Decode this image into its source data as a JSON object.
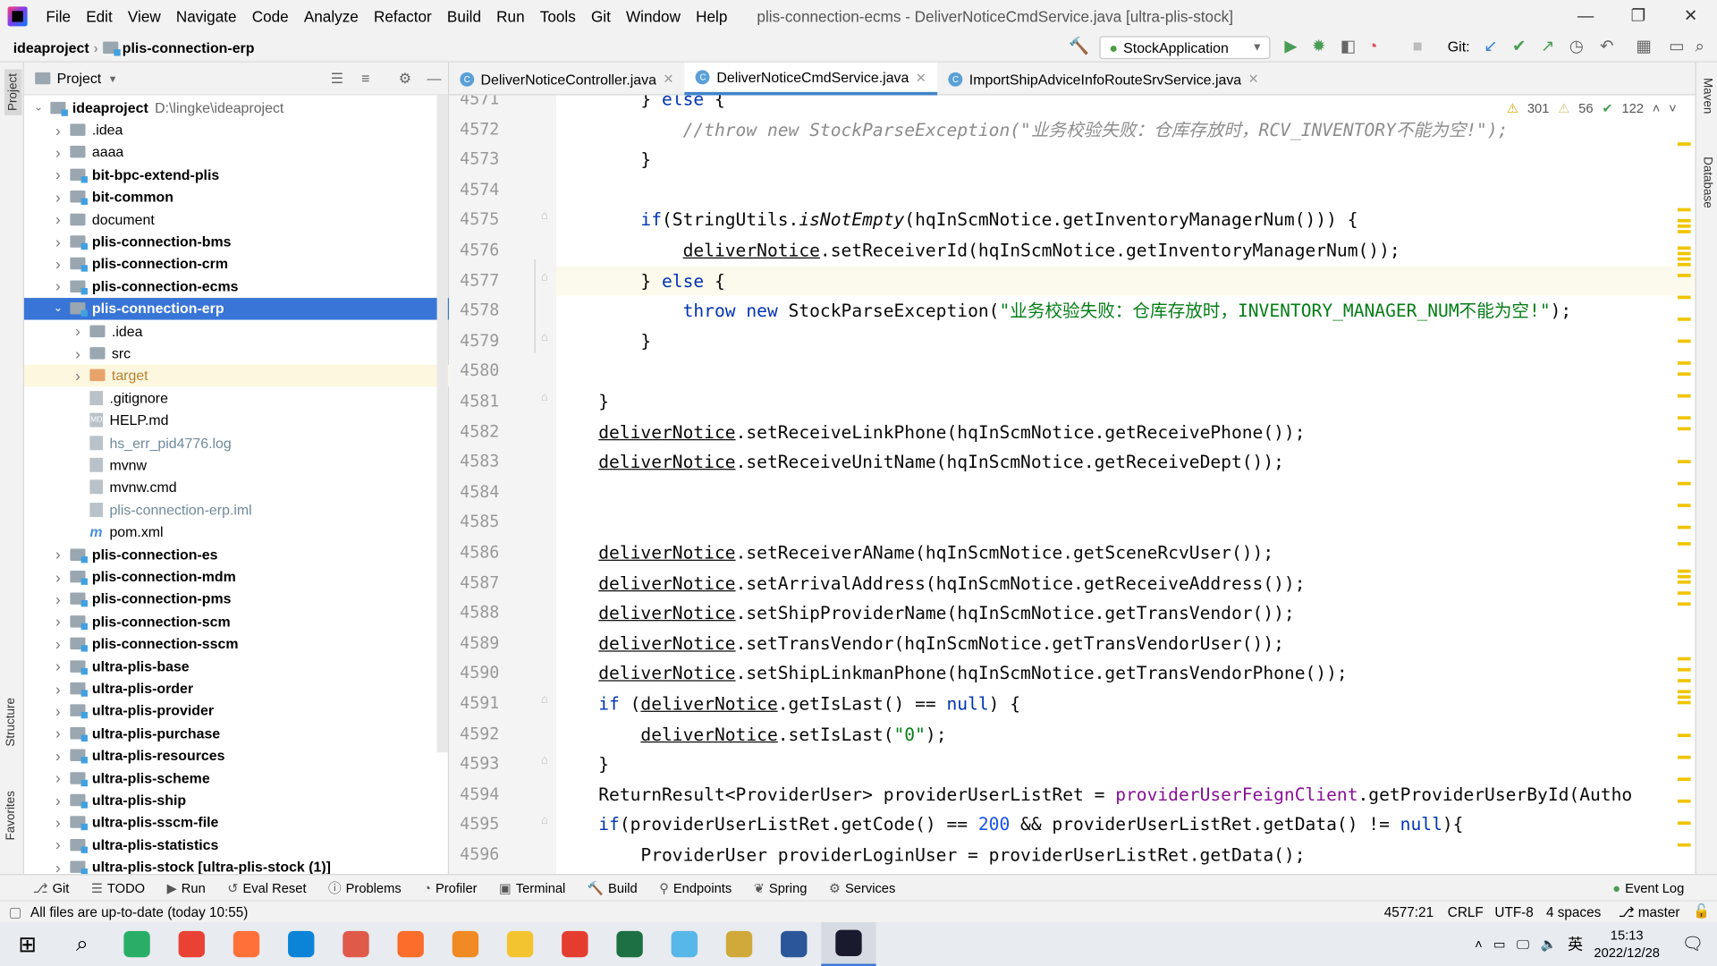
{
  "menu": [
    "File",
    "Edit",
    "View",
    "Navigate",
    "Code",
    "Analyze",
    "Refactor",
    "Build",
    "Run",
    "Tools",
    "Git",
    "Window",
    "Help"
  ],
  "window_title": "plis-connection-ecms - DeliverNoticeCmdService.java [ultra-plis-stock]",
  "breadcrumb": [
    "ideaproject",
    "plis-connection-erp"
  ],
  "run_config": "StockApplication",
  "git_label": "Git:",
  "project_panel": {
    "title": "Project",
    "tree": [
      {
        "label": "ideaproject",
        "path": "D:\\lingke\\ideaproject",
        "depth": 0,
        "expanded": true,
        "bold": true,
        "icon": "folder-module"
      },
      {
        "label": ".idea",
        "depth": 1,
        "icon": "folder"
      },
      {
        "label": "aaaa",
        "depth": 1,
        "icon": "folder"
      },
      {
        "label": "bit-bpc-extend-plis",
        "depth": 1,
        "bold": true,
        "icon": "folder-module"
      },
      {
        "label": "bit-common",
        "depth": 1,
        "bold": true,
        "icon": "folder-module"
      },
      {
        "label": "document",
        "depth": 1,
        "icon": "folder"
      },
      {
        "label": "plis-connection-bms",
        "depth": 1,
        "bold": true,
        "icon": "folder-module"
      },
      {
        "label": "plis-connection-crm",
        "depth": 1,
        "bold": true,
        "icon": "folder-module"
      },
      {
        "label": "plis-connection-ecms",
        "depth": 1,
        "bold": true,
        "icon": "folder-module"
      },
      {
        "label": "plis-connection-erp",
        "depth": 1,
        "bold": true,
        "expanded": true,
        "selected": true,
        "icon": "folder-module"
      },
      {
        "label": ".idea",
        "depth": 2,
        "icon": "folder"
      },
      {
        "label": "src",
        "depth": 2,
        "icon": "folder"
      },
      {
        "label": "target",
        "depth": 2,
        "icon": "folder-excluded",
        "highlight": true
      },
      {
        "label": ".gitignore",
        "depth": 2,
        "leaf": true,
        "icon": "file"
      },
      {
        "label": "HELP.md",
        "depth": 2,
        "leaf": true,
        "icon": "markdown-file"
      },
      {
        "label": "hs_err_pid4776.log",
        "depth": 2,
        "leaf": true,
        "icon": "file",
        "muted": true
      },
      {
        "label": "mvnw",
        "depth": 2,
        "leaf": true,
        "icon": "file"
      },
      {
        "label": "mvnw.cmd",
        "depth": 2,
        "leaf": true,
        "icon": "file"
      },
      {
        "label": "plis-connection-erp.iml",
        "depth": 2,
        "leaf": true,
        "icon": "file",
        "muted": true
      },
      {
        "label": "pom.xml",
        "depth": 2,
        "leaf": true,
        "icon": "maven-file"
      },
      {
        "label": "plis-connection-es",
        "depth": 1,
        "bold": true,
        "icon": "folder-module"
      },
      {
        "label": "plis-connection-mdm",
        "depth": 1,
        "bold": true,
        "icon": "folder-module"
      },
      {
        "label": "plis-connection-pms",
        "depth": 1,
        "bold": true,
        "icon": "folder-module"
      },
      {
        "label": "plis-connection-scm",
        "depth": 1,
        "bold": true,
        "icon": "folder-module"
      },
      {
        "label": "plis-connection-sscm",
        "depth": 1,
        "bold": true,
        "icon": "folder-module"
      },
      {
        "label": "ultra-plis-base",
        "depth": 1,
        "bold": true,
        "icon": "folder-module"
      },
      {
        "label": "ultra-plis-order",
        "depth": 1,
        "bold": true,
        "icon": "folder-module"
      },
      {
        "label": "ultra-plis-provider",
        "depth": 1,
        "bold": true,
        "icon": "folder-module"
      },
      {
        "label": "ultra-plis-purchase",
        "depth": 1,
        "bold": true,
        "icon": "folder-module"
      },
      {
        "label": "ultra-plis-resources",
        "depth": 1,
        "bold": true,
        "icon": "folder-module"
      },
      {
        "label": "ultra-plis-scheme",
        "depth": 1,
        "bold": true,
        "icon": "folder-module"
      },
      {
        "label": "ultra-plis-ship",
        "depth": 1,
        "bold": true,
        "icon": "folder-module"
      },
      {
        "label": "ultra-plis-sscm-file",
        "depth": 1,
        "bold": true,
        "icon": "folder-module"
      },
      {
        "label": "ultra-plis-statistics",
        "depth": 1,
        "bold": true,
        "icon": "folder-module"
      },
      {
        "label": "ultra-plis-stock [ultra-plis-stock (1)]",
        "depth": 1,
        "bold": true,
        "icon": "folder-module"
      }
    ]
  },
  "left_stripe": {
    "top": "Project",
    "mid": "Structure",
    "bottom": "Favorites"
  },
  "right_stripe": {
    "top": "Maven",
    "mid": "Database"
  },
  "tabs": [
    {
      "label": "DeliverNoticeController.java"
    },
    {
      "label": "DeliverNoticeCmdService.java",
      "active": true
    },
    {
      "label": "ImportShipAdviceInfoRouteSrvService.java"
    }
  ],
  "inspections": {
    "warnings": "301",
    "weak_warnings": "56",
    "typos": "122"
  },
  "editor": {
    "current_line": 4577,
    "lines": [
      {
        "n": 4571,
        "t": [
          [
            "        } ",
            ""
          ],
          [
            "else",
            "kw"
          ],
          [
            " {",
            ""
          ]
        ]
      },
      {
        "n": 4572,
        "t": [
          [
            "            //throw new StockParseException(\"业务校验失败：仓库存放时，RCV_INVENTORY不能为空!\");",
            "cm"
          ]
        ]
      },
      {
        "n": 4573,
        "t": [
          [
            "        }",
            ""
          ]
        ]
      },
      {
        "n": 4574,
        "t": []
      },
      {
        "n": 4575,
        "t": [
          [
            "        ",
            ""
          ],
          [
            "if",
            "kw"
          ],
          [
            "(StringUtils.",
            ""
          ],
          [
            "isNotEmpty",
            "it"
          ],
          [
            "(hqInScmNotice.getInventoryManagerNum())) {",
            ""
          ]
        ]
      },
      {
        "n": 4576,
        "t": [
          [
            "            ",
            ""
          ],
          [
            "deliverNotice",
            "var"
          ],
          [
            ".setReceiverId(hqInScmNotice.getInventoryManagerNum());",
            ""
          ]
        ]
      },
      {
        "n": 4577,
        "t": [
          [
            "        } ",
            ""
          ],
          [
            "else",
            "kw"
          ],
          [
            " {",
            ""
          ]
        ]
      },
      {
        "n": 4578,
        "t": [
          [
            "            ",
            ""
          ],
          [
            "throw new",
            "kw"
          ],
          [
            " StockParseException(",
            ""
          ],
          [
            "\"业务校验失败：仓库存放时，INVENTORY_MANAGER_NUM不能为空!\"",
            "str"
          ],
          [
            ");",
            ""
          ]
        ]
      },
      {
        "n": 4579,
        "t": [
          [
            "        }",
            ""
          ]
        ]
      },
      {
        "n": 4580,
        "t": []
      },
      {
        "n": 4581,
        "t": [
          [
            "    }",
            ""
          ]
        ]
      },
      {
        "n": 4582,
        "t": [
          [
            "    ",
            ""
          ],
          [
            "deliverNotice",
            "var"
          ],
          [
            ".setReceiveLinkPhone(hqInScmNotice.getReceivePhone());",
            ""
          ]
        ]
      },
      {
        "n": 4583,
        "t": [
          [
            "    ",
            ""
          ],
          [
            "deliverNotice",
            "var"
          ],
          [
            ".setReceiveUnitName(hqInScmNotice.getReceiveDept());",
            ""
          ]
        ]
      },
      {
        "n": 4584,
        "t": []
      },
      {
        "n": 4585,
        "t": []
      },
      {
        "n": 4586,
        "t": [
          [
            "    ",
            ""
          ],
          [
            "deliverNotice",
            "var"
          ],
          [
            ".setReceiverAName(hqInScmNotice.getSceneRcvUser());",
            ""
          ]
        ]
      },
      {
        "n": 4587,
        "t": [
          [
            "    ",
            ""
          ],
          [
            "deliverNotice",
            "var"
          ],
          [
            ".setArrivalAddress(hqInScmNotice.getReceiveAddress());",
            ""
          ]
        ]
      },
      {
        "n": 4588,
        "t": [
          [
            "    ",
            ""
          ],
          [
            "deliverNotice",
            "var"
          ],
          [
            ".setShipProviderName(hqInScmNotice.getTransVendor());",
            ""
          ]
        ]
      },
      {
        "n": 4589,
        "t": [
          [
            "    ",
            ""
          ],
          [
            "deliverNotice",
            "var"
          ],
          [
            ".setTransVendor(hqInScmNotice.getTransVendorUser());",
            ""
          ]
        ]
      },
      {
        "n": 4590,
        "t": [
          [
            "    ",
            ""
          ],
          [
            "deliverNotice",
            "var"
          ],
          [
            ".setShipLinkmanPhone(hqInScmNotice.getTransVendorPhone());",
            ""
          ]
        ]
      },
      {
        "n": 4591,
        "t": [
          [
            "    ",
            ""
          ],
          [
            "if",
            "kw"
          ],
          [
            " (",
            ""
          ],
          [
            "deliverNotice",
            "var"
          ],
          [
            ".getIsLast() == ",
            ""
          ],
          [
            "null",
            "kw"
          ],
          [
            ") {",
            ""
          ]
        ]
      },
      {
        "n": 4592,
        "t": [
          [
            "        ",
            ""
          ],
          [
            "deliverNotice",
            "var"
          ],
          [
            ".setIsLast(",
            ""
          ],
          [
            "\"0\"",
            "str"
          ],
          [
            ");",
            ""
          ]
        ]
      },
      {
        "n": 4593,
        "t": [
          [
            "    }",
            ""
          ]
        ]
      },
      {
        "n": 4594,
        "t": [
          [
            "    ReturnResult<ProviderUser> providerUserListRet = ",
            ""
          ],
          [
            "providerUserFeignClient",
            "fld"
          ],
          [
            ".getProviderUserById(Autho",
            ""
          ]
        ]
      },
      {
        "n": 4595,
        "t": [
          [
            "    ",
            ""
          ],
          [
            "if",
            "kw"
          ],
          [
            "(providerUserListRet.getCode() == ",
            ""
          ],
          [
            "200",
            "num"
          ],
          [
            " && providerUserListRet.getData() != ",
            ""
          ],
          [
            "null",
            "kw"
          ],
          [
            "){",
            ""
          ]
        ]
      },
      {
        "n": 4596,
        "t": [
          [
            "        ProviderUser providerLoginUser = providerUserListRet.getData();",
            ""
          ]
        ]
      }
    ]
  },
  "bottom_tools": [
    {
      "label": "Git",
      "icon": "git-icon"
    },
    {
      "label": "TODO",
      "icon": "list-icon"
    },
    {
      "label": "Run",
      "icon": "run-icon"
    },
    {
      "label": "Eval Reset",
      "icon": "reset-icon"
    },
    {
      "label": "Problems",
      "icon": "problems-icon"
    },
    {
      "label": "Profiler",
      "icon": "profiler-icon"
    },
    {
      "label": "Terminal",
      "icon": "terminal-icon"
    },
    {
      "label": "Build",
      "icon": "build-icon"
    },
    {
      "label": "Endpoints",
      "icon": "endpoints-icon"
    },
    {
      "label": "Spring",
      "icon": "spring-icon"
    },
    {
      "label": "Services",
      "icon": "services-icon"
    }
  ],
  "event_log": "Event Log",
  "status": {
    "message": "All files are up-to-date (today 10:55)",
    "position": "4577:21",
    "line_sep": "CRLF",
    "encoding": "UTF-8",
    "indent": "4 spaces",
    "branch": "master"
  },
  "taskbar": {
    "time": "15:13",
    "date": "2022/12/28",
    "ime": "英",
    "apps": [
      "#2aae67",
      "#e94235",
      "#ff7139",
      "#0b84d8",
      "#e05a4a",
      "#fb6d2a",
      "#f08a24",
      "#f4c430",
      "#e43d30",
      "#1d7044",
      "#57b7e8",
      "#cfa93a",
      "#2b579a",
      "#1a1a2e"
    ]
  }
}
